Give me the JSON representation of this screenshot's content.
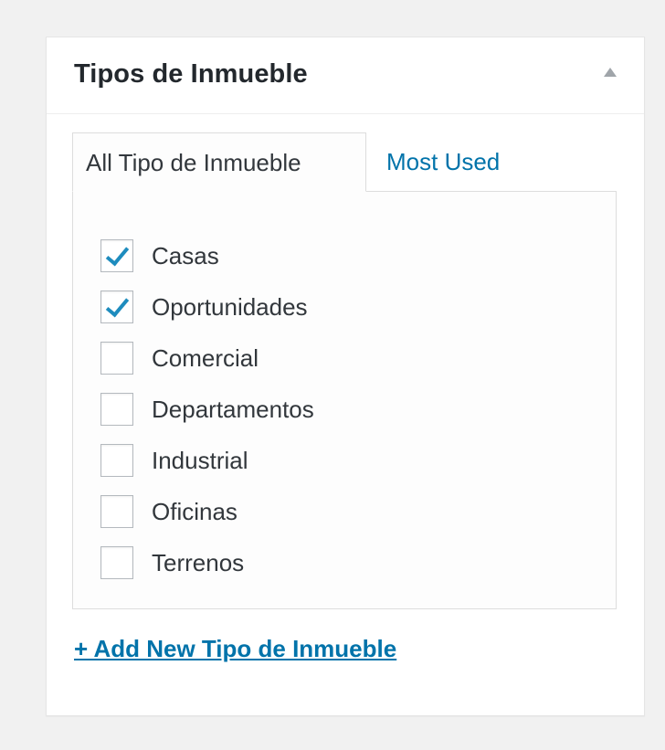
{
  "metabox": {
    "title": "Tipos de Inmueble",
    "toggle_icon": "arrow-up-icon"
  },
  "tabs": [
    {
      "label": "All Tipo de Inmueble",
      "active": true
    },
    {
      "label": "Most Used",
      "active": false
    }
  ],
  "categories": [
    {
      "label": "Casas",
      "checked": true
    },
    {
      "label": "Oportunidades",
      "checked": true
    },
    {
      "label": "Comercial",
      "checked": false
    },
    {
      "label": "Departamentos",
      "checked": false
    },
    {
      "label": "Industrial",
      "checked": false
    },
    {
      "label": "Oficinas",
      "checked": false
    },
    {
      "label": "Terrenos",
      "checked": false
    }
  ],
  "add_new_label": "+ Add New Tipo de Inmueble",
  "colors": {
    "link": "#0073aa",
    "checkmark": "#1e8cbe",
    "text": "#32373c",
    "background": "#f1f1f1"
  }
}
